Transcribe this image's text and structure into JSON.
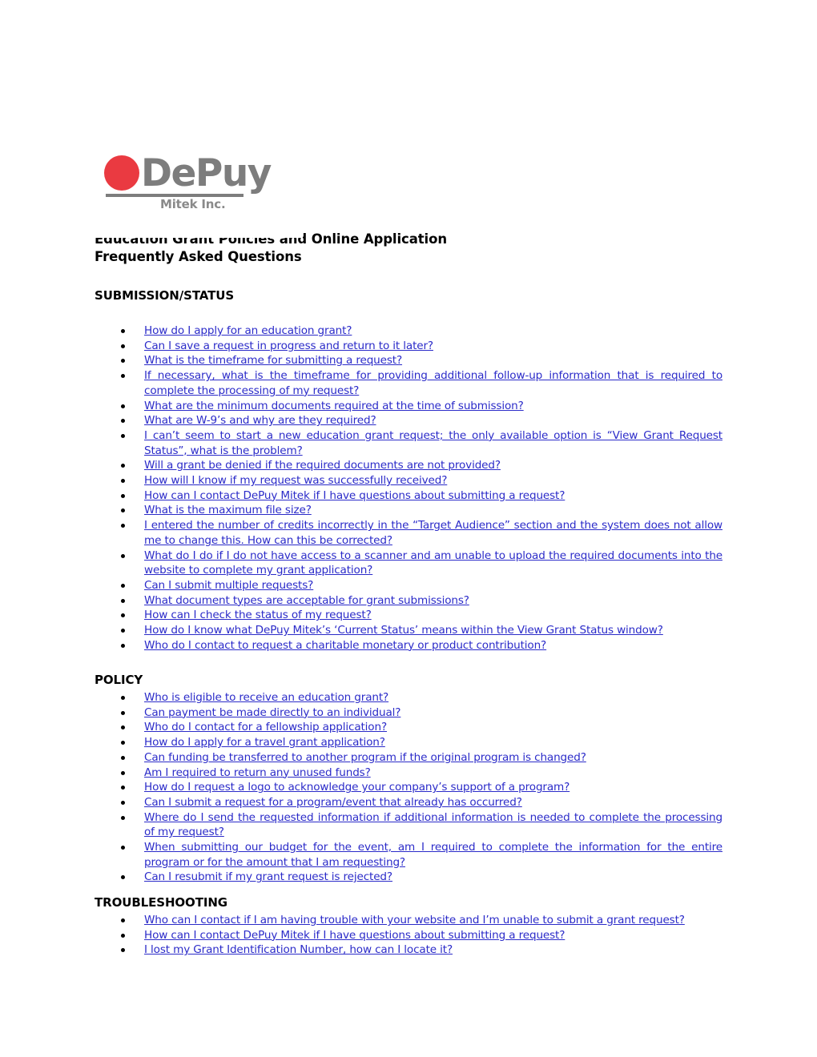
{
  "document": {
    "title_line_1": "Education Grant Policies and Online Application",
    "title_line_2": "Frequently Asked Questions"
  },
  "logo": {
    "wordmark": "DePuy",
    "subtitle": "Mitek Inc.",
    "dot_color": "#ea3a41",
    "text_color": "#7d7d7d"
  },
  "colors": {
    "link": "#2b2bc9",
    "text": "#000000",
    "background": "#ffffff"
  },
  "sections": [
    {
      "heading": "SUBMISSION/STATUS",
      "items": [
        "How do I apply for an education grant?",
        "Can I save a request in progress and return to it later?",
        "What is the timeframe for submitting a request?",
        "If necessary, what is the timeframe for providing additional follow-up information that is required to complete the processing of my request?",
        "What are the minimum documents required at the time of submission?",
        "What are W-9’s and why are they required?",
        "I can’t seem to start a new education grant request; the only available option is “View Grant Request Status”, what is the problem?",
        "Will a grant be denied if the required documents are not provided?",
        "How will I know if my request was successfully received?",
        "How can I contact DePuy Mitek if I have questions about submitting a request?",
        "What is the maximum file size?",
        "I entered the number of credits incorrectly in the “Target Audience” section and the system does not allow me to change this.  How can this be corrected?",
        "What do I do if I do not have access to a scanner and am unable to upload the required documents into the website to complete my grant application?",
        "Can I submit multiple requests?",
        "What document types are acceptable for grant submissions?",
        "How can I check the status of my request?",
        "How do I know what DePuy Mitek’s ‘Current Status’ means within the View Grant Status window?",
        "Who do I contact to request a charitable monetary or product contribution?"
      ]
    },
    {
      "heading": "POLICY",
      "items": [
        "Who is eligible to receive an education grant?",
        "Can payment be made directly to an individual?",
        "Who do I contact for a fellowship application?",
        "How do I apply for a travel grant application?",
        "Can funding be transferred to another program if the original program is changed?",
        "Am I required to return any unused funds?",
        "How do I request a logo to acknowledge your company’s support of a program?",
        "Can I submit a request for a program/event that already has occurred?",
        "Where do I send the requested information if additional information is needed to complete the processing of my request?",
        "When submitting our budget for the event, am I required to complete the information for the entire program or for the amount that I am requesting?",
        "Can I resubmit if my grant request is rejected?"
      ]
    },
    {
      "heading": "TROUBLESHOOTING",
      "items": [
        "Who can I contact if I am having trouble with your website and I’m unable to submit a grant request?",
        "How can I contact DePuy Mitek if I have questions about submitting a request?",
        "I lost my Grant Identification Number, how can I locate it?"
      ]
    }
  ]
}
